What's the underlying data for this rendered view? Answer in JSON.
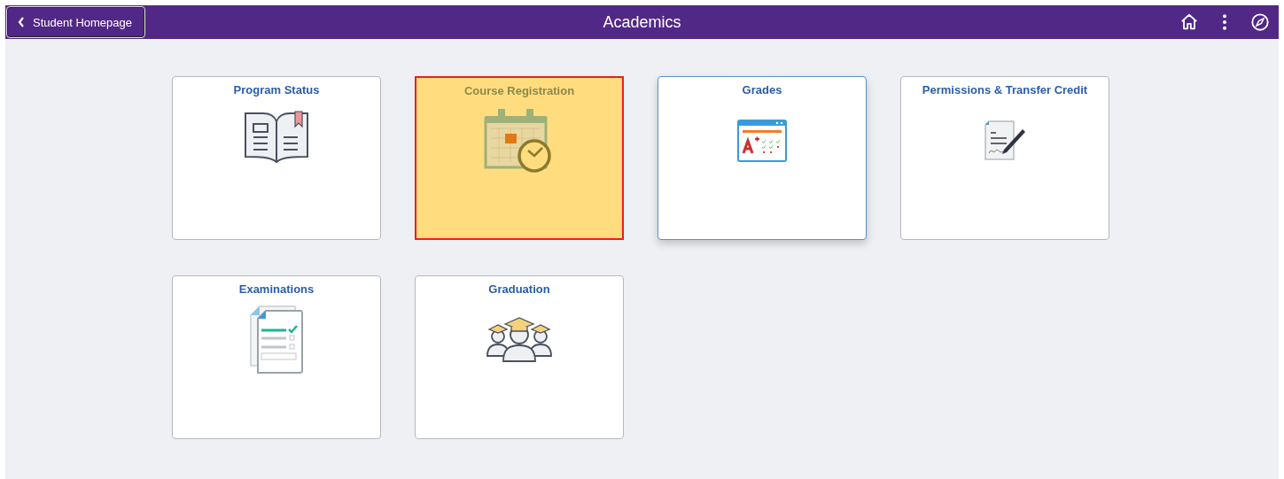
{
  "header": {
    "back_button": "Student Homepage",
    "title": "Academics"
  },
  "tiles": [
    {
      "title": "Program Status",
      "highlighted": false,
      "focused": false
    },
    {
      "title": "Course Registration",
      "highlighted": true,
      "focused": false
    },
    {
      "title": "Grades",
      "highlighted": false,
      "focused": true
    },
    {
      "title": "Permissions & Transfer Credit",
      "highlighted": false,
      "focused": false
    },
    {
      "title": "Examinations",
      "highlighted": false,
      "focused": false
    },
    {
      "title": "Graduation",
      "highlighted": false,
      "focused": false
    }
  ]
}
